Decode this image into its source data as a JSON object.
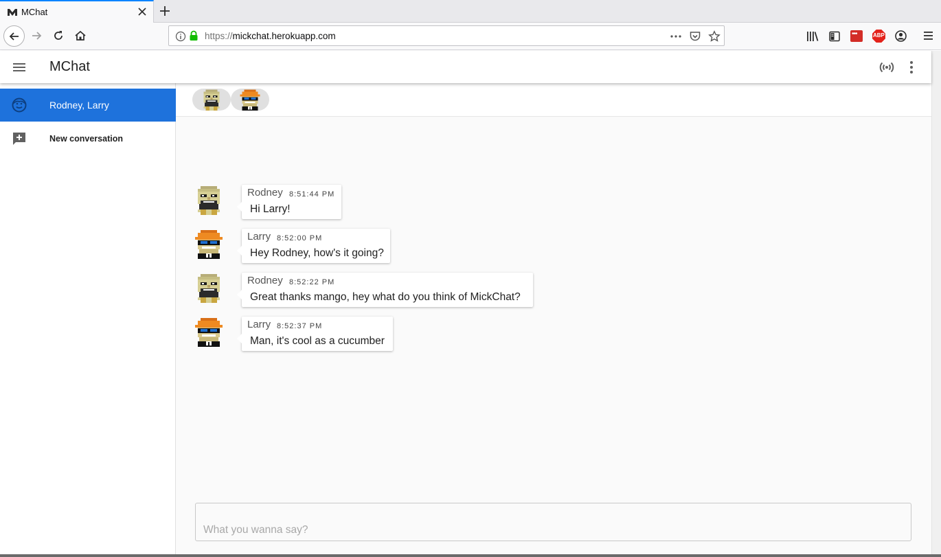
{
  "browser": {
    "tab_title": "MChat",
    "url_scheme": "https://",
    "url_host": "mickchat.herokuapp.com",
    "icons": [
      "back-icon",
      "forward-icon",
      "reload-icon",
      "home-icon",
      "info-icon",
      "lock-icon",
      "page-actions-icon",
      "pocket-icon",
      "bookmark-star-icon",
      "library-icon",
      "sidebar-icon",
      "lastpass-icon",
      "adblock-icon",
      "account-icon",
      "hamburger-menu-icon"
    ],
    "extension_labels": {
      "lastpass": "•••",
      "adblock": "ABP"
    }
  },
  "appbar": {
    "title": "MChat",
    "icons": [
      "menu-icon",
      "broadcast-icon",
      "more-vert-icon"
    ]
  },
  "sidebar": {
    "active_conversation": "Rodney, Larry",
    "new_conversation_label": "New conversation"
  },
  "participants": [
    "Rodney",
    "Larry"
  ],
  "messages": [
    {
      "author": "Rodney",
      "time": "8:51:44 PM",
      "text": "Hi Larry!"
    },
    {
      "author": "Larry",
      "time": "8:52:00 PM",
      "text": "Hey Rodney, how's it going?"
    },
    {
      "author": "Rodney",
      "time": "8:52:22 PM",
      "text": "Great thanks mango, hey what do you think of MickChat?"
    },
    {
      "author": "Larry",
      "time": "8:52:37 PM",
      "text": "Man, it's cool as a cucumber"
    }
  ],
  "composer": {
    "placeholder": "What you wanna say?",
    "value": ""
  },
  "colors": {
    "accent": "#1e72dc",
    "tab_highlight": "#0a84ff",
    "lock_green": "#12bc00"
  }
}
